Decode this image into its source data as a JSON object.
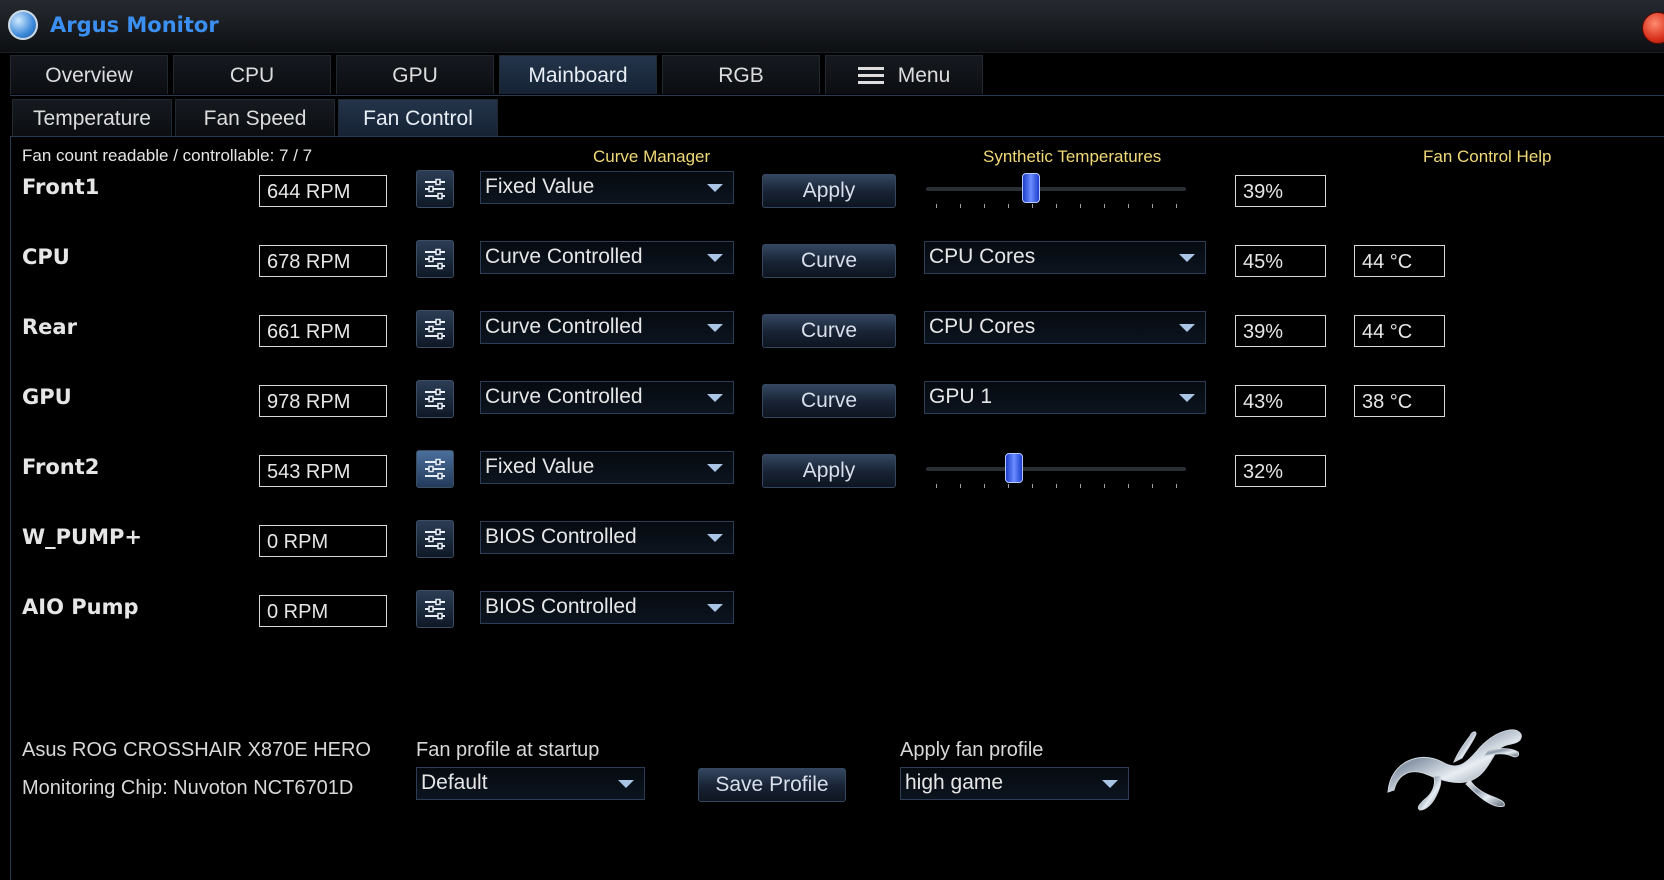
{
  "window": {
    "title": "Argus Monitor"
  },
  "main_tabs": [
    {
      "label": "Overview"
    },
    {
      "label": "CPU"
    },
    {
      "label": "GPU"
    },
    {
      "label": "Mainboard",
      "active": true
    },
    {
      "label": "RGB"
    },
    {
      "label": "Menu"
    }
  ],
  "sub_tabs": [
    {
      "label": "Temperature"
    },
    {
      "label": "Fan Speed"
    },
    {
      "label": "Fan Control",
      "active": true
    }
  ],
  "header": {
    "fan_count": "Fan count readable / controllable: 7 / 7",
    "curve_manager": "Curve Manager",
    "synthetic_temperatures": "Synthetic Temperatures",
    "fan_control_help": "Fan Control Help"
  },
  "fans": [
    {
      "name": "Front1",
      "rpm": "644 RPM",
      "mode": "Fixed Value",
      "action": "Apply",
      "percent": "39%",
      "slider_value": 0.39
    },
    {
      "name": "CPU",
      "rpm": "678 RPM",
      "mode": "Curve Controlled",
      "action": "Curve",
      "source": "CPU Cores",
      "percent": "45%",
      "temp": "44 °C"
    },
    {
      "name": "Rear",
      "rpm": "661 RPM",
      "mode": "Curve Controlled",
      "action": "Curve",
      "source": "CPU Cores",
      "percent": "39%",
      "temp": "44 °C"
    },
    {
      "name": "GPU",
      "rpm": "978 RPM",
      "mode": "Curve Controlled",
      "action": "Curve",
      "source": "GPU 1",
      "percent": "43%",
      "temp": "38 °C"
    },
    {
      "name": "Front2",
      "rpm": "543 RPM",
      "mode": "Fixed Value",
      "action": "Apply",
      "percent": "32%",
      "slider_value": 0.32
    },
    {
      "name": "W_PUMP+",
      "rpm": "0 RPM",
      "mode": "BIOS Controlled"
    },
    {
      "name": "AIO Pump",
      "rpm": "0 RPM",
      "mode": "BIOS Controlled"
    }
  ],
  "footer": {
    "board": "Asus ROG CROSSHAIR X870E HERO",
    "chip": "Monitoring Chip: Nuvoton NCT6701D",
    "startup_label": "Fan profile at startup",
    "startup_value": "Default",
    "save_profile": "Save Profile",
    "apply_label": "Apply fan profile",
    "apply_value": "high game"
  },
  "colors": {
    "accent": "#3b8ff0",
    "link": "#f1d977",
    "background": "#000000"
  }
}
